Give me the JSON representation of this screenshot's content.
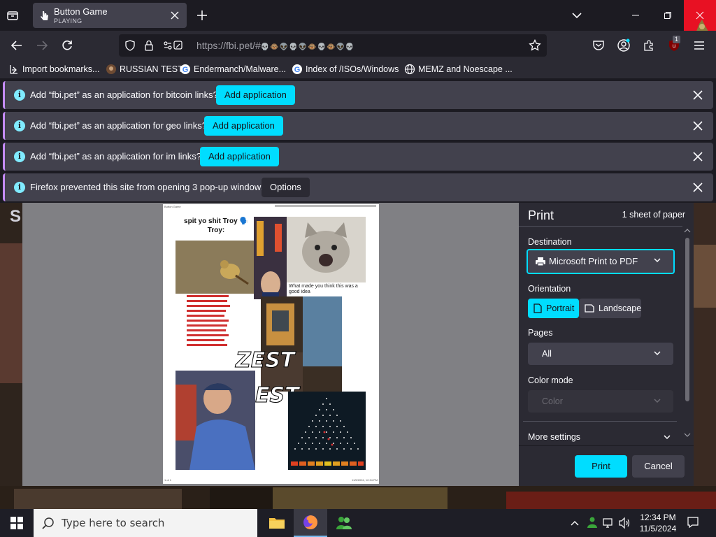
{
  "browser": {
    "tab": {
      "title": "Button Game",
      "subtitle": "PLAYING"
    },
    "url": "https://fbi.pet/#",
    "url_emoji": "💀🐵👽💀👽🐵💀🐵👽💀",
    "extension_badge": "1"
  },
  "bookmarks": [
    {
      "label": "Import bookmarks...",
      "icon": "import-icon"
    },
    {
      "label": "RUSSIAN TEST",
      "icon": "site-icon"
    },
    {
      "label": "Endermanch/Malware...",
      "icon": "google-icon"
    },
    {
      "label": "Index of /ISOs/Windows",
      "icon": "google-icon"
    },
    {
      "label": "MEMZ and Noescape ...",
      "icon": "globe-icon"
    }
  ],
  "notifications": [
    {
      "message": "Add “fbi.pet” as an application for bitcoin links?",
      "button": "Add application"
    },
    {
      "message": "Add “fbi.pet” as an application for geo links?",
      "button": "Add application"
    },
    {
      "message": "Add “fbi.pet” as an application for im links?",
      "button": "Add application"
    },
    {
      "message": "Firefox prevented this site from opening 3 pop-up windows.",
      "button": "Options"
    }
  ],
  "page_partial_text": "S",
  "print_preview": {
    "heading": "spit yo shit Troy 🗣️ Troy:",
    "zest_text": "ZEST",
    "zest_partial": "EST",
    "meme_caption": "What made you think this was a good idea",
    "header_left": "Button Game",
    "footer_left": "1 of 1",
    "footer_right": "11/5/2024, 12:34 PM"
  },
  "print_panel": {
    "title": "Print",
    "sheets": "1 sheet of paper",
    "destination_label": "Destination",
    "destination_value": "Microsoft Print to PDF",
    "orientation_label": "Orientation",
    "portrait": "Portrait",
    "landscape": "Landscape",
    "pages_label": "Pages",
    "pages_value": "All",
    "color_label": "Color mode",
    "color_value": "Color",
    "more_settings": "More settings",
    "print_button": "Print",
    "cancel_button": "Cancel"
  },
  "taskbar": {
    "search_placeholder": "Type here to search",
    "time": "12:34 PM",
    "date": "11/5/2024"
  },
  "colors": {
    "accent": "#00ddff",
    "notification_border": "#c58cf8",
    "toolbar": "#2b2a33",
    "close_red": "#e81123"
  }
}
